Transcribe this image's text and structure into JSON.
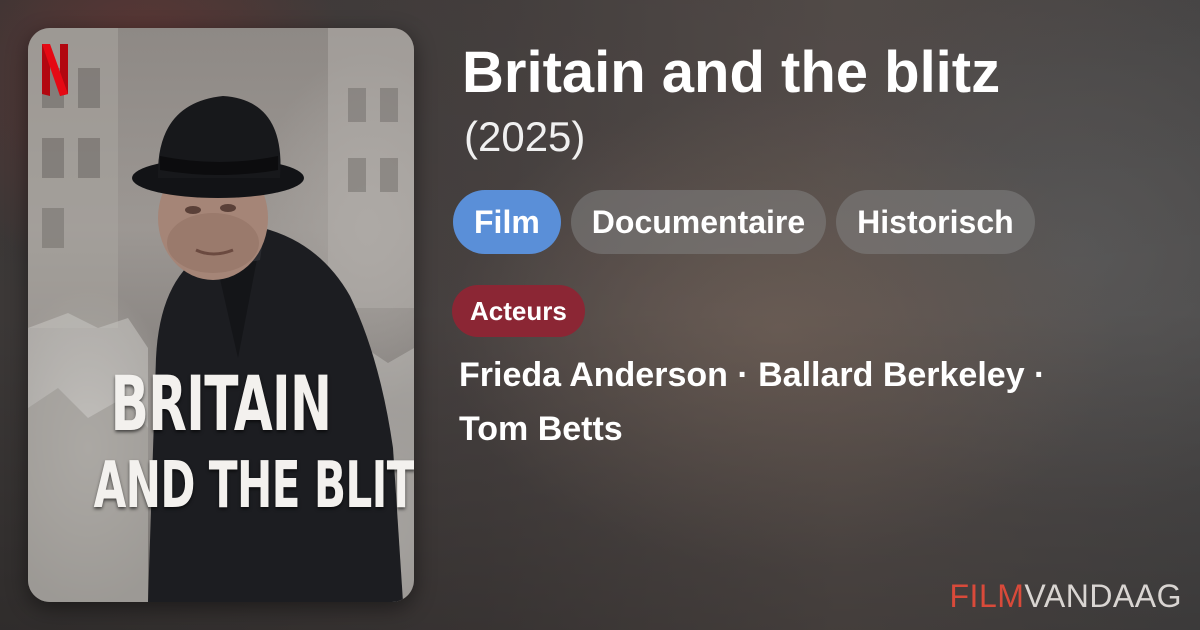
{
  "movie": {
    "title": "Britain and the blitz",
    "year": "(2025)"
  },
  "tags": [
    {
      "label": "Film",
      "primary": true
    },
    {
      "label": "Documentaire",
      "primary": false
    },
    {
      "label": "Historisch",
      "primary": false
    }
  ],
  "cast": {
    "label": "Acteurs",
    "line1": "Frieda Anderson · Ballard Berkeley ·",
    "line2": "Tom Betts"
  },
  "poster": {
    "title_line1": "BRITAIN",
    "title_line2": "AND THE BLITZ",
    "logo_letter": "N"
  },
  "brand": {
    "part1": "FILM",
    "part2": "VANDAAG"
  },
  "colors": {
    "primary_tag": "#5a8fd8",
    "secondary_tag": "#7a7877",
    "section_label": "#8b2634",
    "brand_accent": "#d94a3a",
    "netflix_red": "#e50914"
  }
}
